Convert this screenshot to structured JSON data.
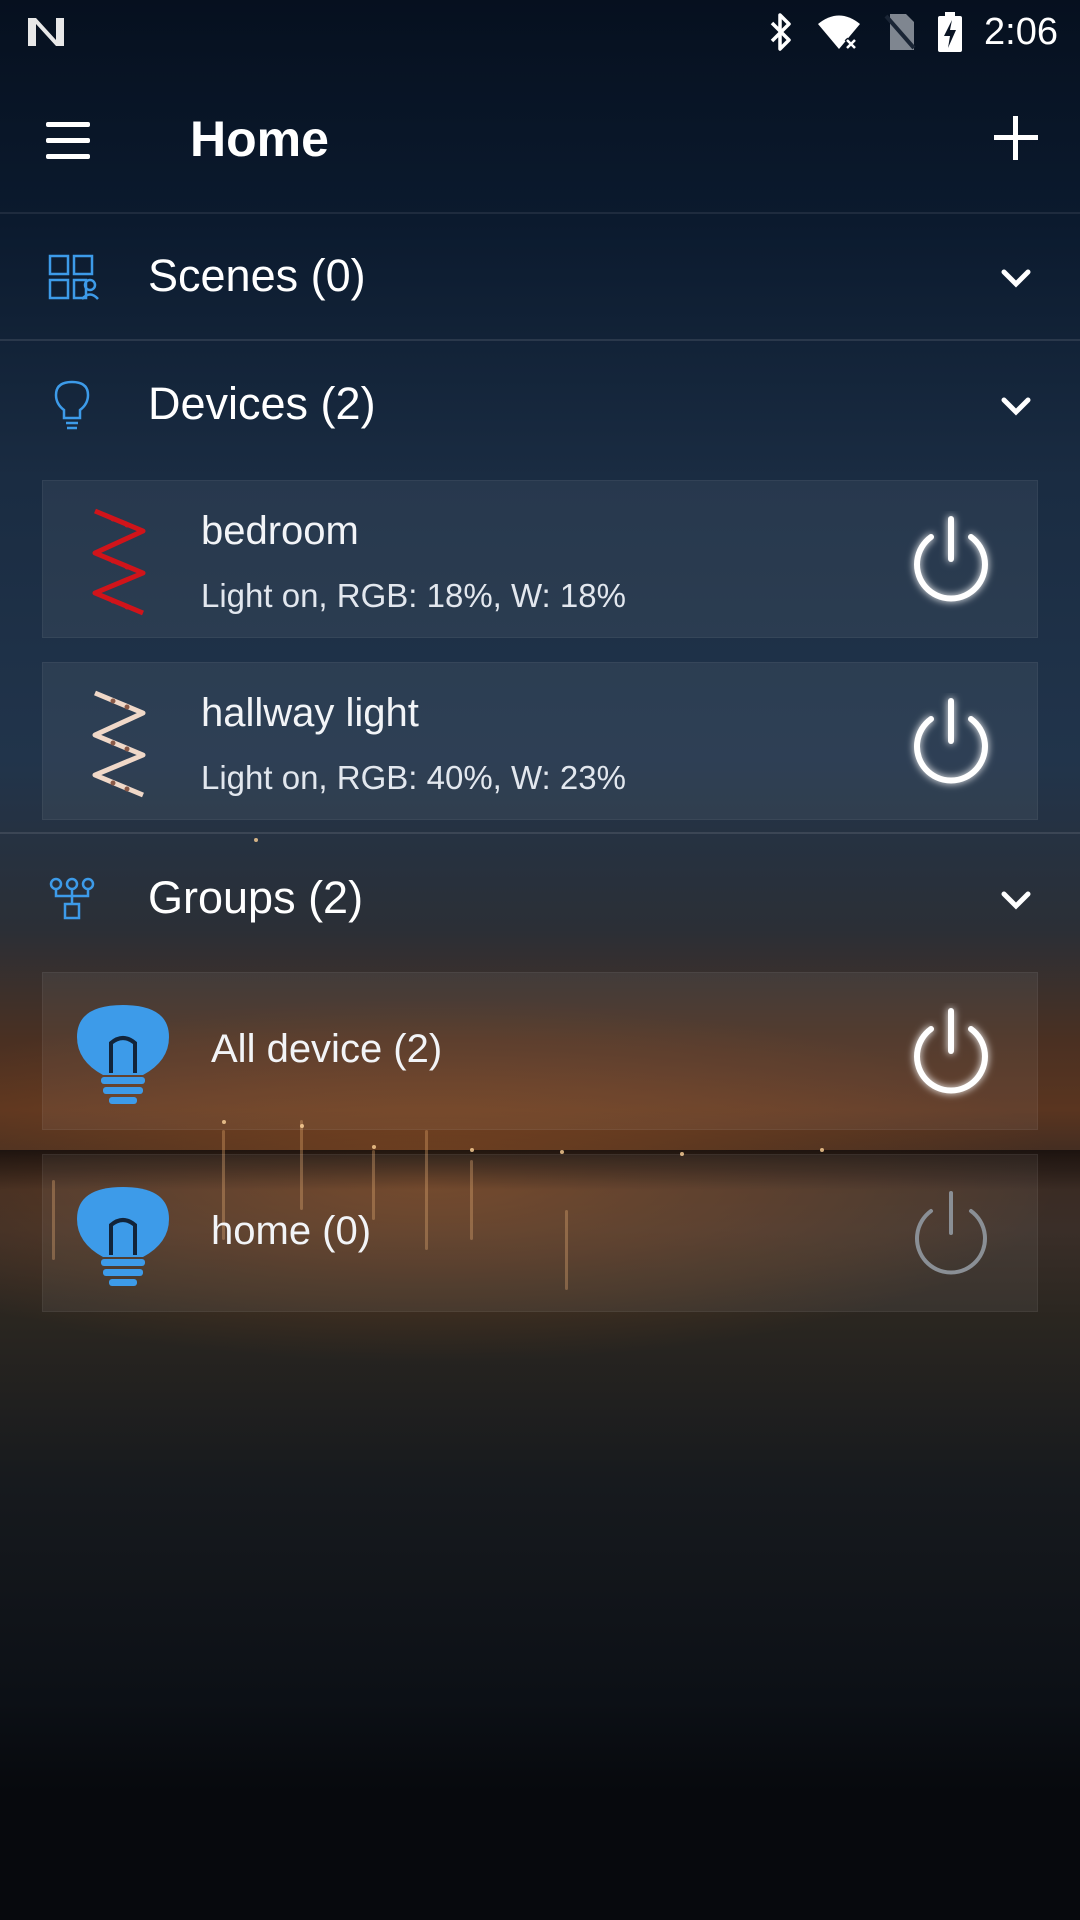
{
  "status_bar": {
    "time": "2:06",
    "icons": [
      "n-logo-icon",
      "bluetooth-icon",
      "wifi-icon",
      "no-sim-icon",
      "battery-charging-icon"
    ]
  },
  "app_bar": {
    "title": "Home",
    "menu_icon": "menu-icon",
    "add_icon": "plus-icon"
  },
  "scenes": {
    "label": "Scenes (0)",
    "icon": "scenes-icon"
  },
  "devices": {
    "label": "Devices (2)",
    "icon": "lightbulb-outline-icon",
    "items": [
      {
        "name": "bedroom",
        "status": "Light on, RGB: 18%, W: 18%",
        "icon": "led-strip-icon",
        "icon_color": "#d0141a",
        "on": true
      },
      {
        "name": "hallway light",
        "status": "Light on, RGB: 40%, W: 23%",
        "icon": "led-strip-icon",
        "icon_color": "#f0d8c8",
        "on": true
      }
    ]
  },
  "groups": {
    "label": "Groups (2)",
    "icon": "group-tree-icon",
    "items": [
      {
        "name": "All device (2)",
        "icon": "bulb-icon",
        "on": true
      },
      {
        "name": "home (0)",
        "icon": "bulb-icon",
        "on": false
      }
    ]
  },
  "colors": {
    "accent": "#3d9be9",
    "power_on": "#ffffff",
    "power_off": "#8a8f95"
  }
}
